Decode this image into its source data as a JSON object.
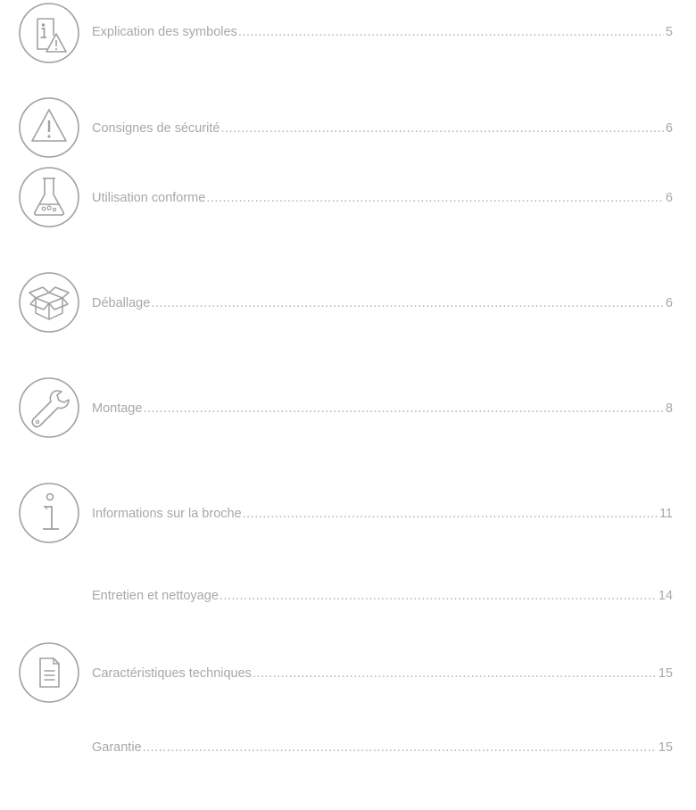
{
  "toc": {
    "entries": [
      {
        "title": "Explication des symboles",
        "page": "5",
        "icon": "info-warning-icon"
      },
      {
        "title": "Consignes de sécurité",
        "page": "6",
        "icon": "warning-triangle-icon"
      },
      {
        "title": "Utilisation conforme",
        "page": "6",
        "icon": "flask-icon"
      },
      {
        "title": "Déballage",
        "page": "6",
        "icon": "box-icon"
      },
      {
        "title": "Montage",
        "page": "8",
        "icon": "wrench-icon"
      },
      {
        "title": "Informations sur la broche",
        "page": "11",
        "icon": "info-icon"
      },
      {
        "title": "Entretien et nettoyage",
        "page": "14",
        "icon": ""
      },
      {
        "title": "Caractéristiques techniques",
        "page": "15",
        "icon": "document-icon"
      },
      {
        "title": "Garantie",
        "page": "15",
        "icon": ""
      }
    ]
  },
  "colors": {
    "text": "#a8a8a8",
    "icon_stroke": "#a0a0a0"
  }
}
